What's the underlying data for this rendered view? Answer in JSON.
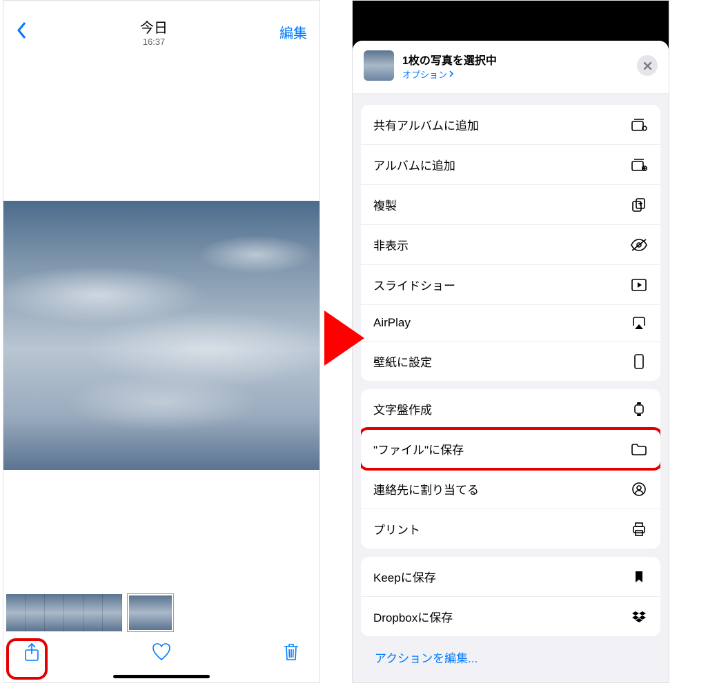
{
  "left": {
    "title": "今日",
    "time": "16:37",
    "edit": "編集"
  },
  "sheet": {
    "title": "1枚の写真を選択中",
    "options": "オプション",
    "actions_group1": [
      {
        "label": "共有アルバムに追加",
        "icon": "shared-album-icon"
      },
      {
        "label": "アルバムに追加",
        "icon": "album-add-icon"
      },
      {
        "label": "複製",
        "icon": "duplicate-icon"
      },
      {
        "label": "非表示",
        "icon": "hide-icon"
      },
      {
        "label": "スライドショー",
        "icon": "slideshow-icon"
      },
      {
        "label": "AirPlay",
        "icon": "airplay-icon"
      },
      {
        "label": "壁紙に設定",
        "icon": "wallpaper-icon"
      }
    ],
    "actions_group2": [
      {
        "label": "文字盤作成",
        "icon": "watchface-icon"
      },
      {
        "label": "\"ファイル\"に保存",
        "icon": "folder-icon",
        "highlight": true
      },
      {
        "label": "連絡先に割り当てる",
        "icon": "contact-icon"
      },
      {
        "label": "プリント",
        "icon": "print-icon"
      }
    ],
    "actions_group3": [
      {
        "label": "Keepに保存",
        "icon": "bookmark-icon"
      },
      {
        "label": "Dropboxに保存",
        "icon": "dropbox-icon"
      }
    ],
    "edit_actions": "アクションを編集..."
  }
}
